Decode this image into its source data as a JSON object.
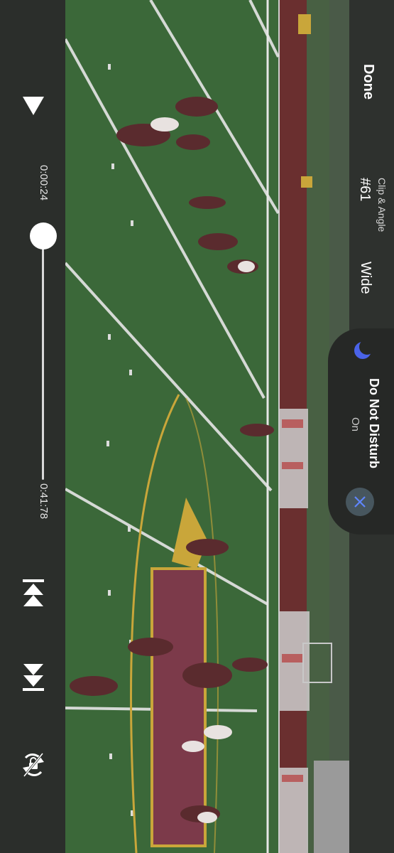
{
  "header": {
    "done_label": "Done",
    "clip_angle_label": "Clip & Angle",
    "clip_number": "#61",
    "angle_value": "Wide"
  },
  "player": {
    "current_time": "0:00:24",
    "total_time": "0:41:78",
    "progress": 0.0057,
    "play_icon": "play-icon",
    "previous_clip_icon": "skip-back-icon",
    "next_clip_icon": "skip-forward-icon",
    "rotation_lock_icon": "rotation-lock-icon"
  },
  "notification": {
    "title": "Do Not Disturb",
    "status": "On",
    "icon": "moon-icon",
    "close_icon": "close-icon",
    "accent_color": "#4a63e8"
  },
  "colors": {
    "field_green": "#3d6a3a",
    "logo_maroon": "#7c3a4a",
    "control_bar": "#2b2e2b"
  }
}
